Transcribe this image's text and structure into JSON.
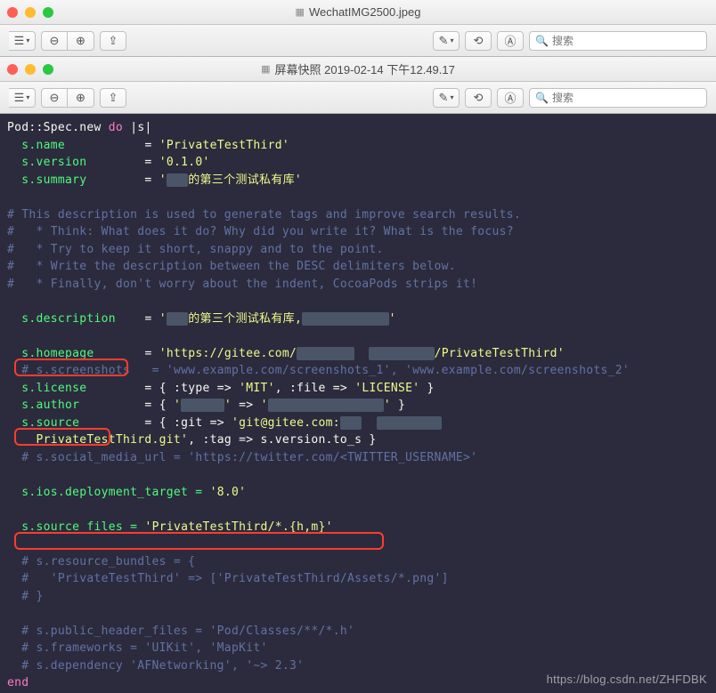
{
  "window1": {
    "title": "WechatIMG2500.jpeg",
    "toolbar": {
      "search_placeholder": "搜索"
    }
  },
  "window2": {
    "title": "屏幕快照 2019-02-14 下午12.49.17",
    "toolbar": {
      "search_placeholder": "搜索"
    }
  },
  "code": {
    "line1_a": "Pod::Spec.new",
    "line1_b": "do",
    "line1_c": "|s|",
    "line2_key": "s.name",
    "line2_eq": "=",
    "line2_val": "'PrivateTestThird'",
    "line3_key": "s.version",
    "line3_eq": "=",
    "line3_val": "'0.1.0'",
    "line4_key": "s.summary",
    "line4_eq": "=",
    "line4_val_a": "'",
    "line4_val_b": "的第三个测试私有库'",
    "comment1": "# This description is used to generate tags and improve search results.",
    "comment2": "#   * Think: What does it do? Why did you write it? What is the focus?",
    "comment3": "#   * Try to keep it short, snappy and to the point.",
    "comment4": "#   * Write the description between the DESC delimiters below.",
    "comment5": "#   * Finally, don't worry about the indent, CocoaPods strips it!",
    "line_desc_key": "s.description",
    "line_desc_eq": "=",
    "line_desc_val_a": "'",
    "line_desc_val_b": "的第三个测试私有库,",
    "line_desc_val_c": "'",
    "line_home_key": "s.homepage",
    "line_home_eq": "=",
    "line_home_val_a": "'https://gitee.com/",
    "line_home_val_b": "/PrivateTestThird'",
    "line_shot_key": "# s.screenshots",
    "line_shot_eq": "=",
    "line_shot_val": "'www.example.com/screenshots_1', 'www.example.com/screenshots_2'",
    "line_lic_key": "s.license",
    "line_lic_eq": "=",
    "line_lic_a": "{ :type =>",
    "line_lic_b": "'MIT'",
    "line_lic_c": ", :file =>",
    "line_lic_d": "'LICENSE'",
    "line_lic_e": "}",
    "line_auth_key": "s.author",
    "line_auth_eq": "=",
    "line_auth_a": "{",
    "line_auth_b": "'",
    "line_auth_c": "'",
    "line_auth_d": "=>",
    "line_auth_e": "'",
    "line_auth_f": "'",
    "line_auth_g": "}",
    "line_src_key": "s.source",
    "line_src_eq": "=",
    "line_src_a": "{ :git =>",
    "line_src_b": "'git@gitee.com:",
    "line_src2_a": "PrivateTestThird.git'",
    "line_src2_b": ", :tag => s.version.to_s }",
    "line_social": "# s.social_media_url = ",
    "line_social_val": "'https://twitter.com/<TWITTER_USERNAME>'",
    "line_ios_key": "s.ios.deployment_target =",
    "line_ios_val": "'8.0'",
    "line_sf_key": "s.source_files =",
    "line_sf_val": "'PrivateTestThird/*.{h,m}'",
    "line_rb1": "# s.resource_bundles = {",
    "line_rb2": "#   'PrivateTestThird' => ['PrivateTestThird/Assets/*.png']",
    "line_rb3": "# }",
    "line_ph": "# s.public_header_files = 'Pod/Classes/**/*.h'",
    "line_fw": "# s.frameworks = 'UIKit', 'MapKit'",
    "line_dep": "# s.dependency 'AFNetworking', '~> 2.3'",
    "line_end": "end"
  },
  "watermark": "https://blog.csdn.net/ZHFDBK"
}
